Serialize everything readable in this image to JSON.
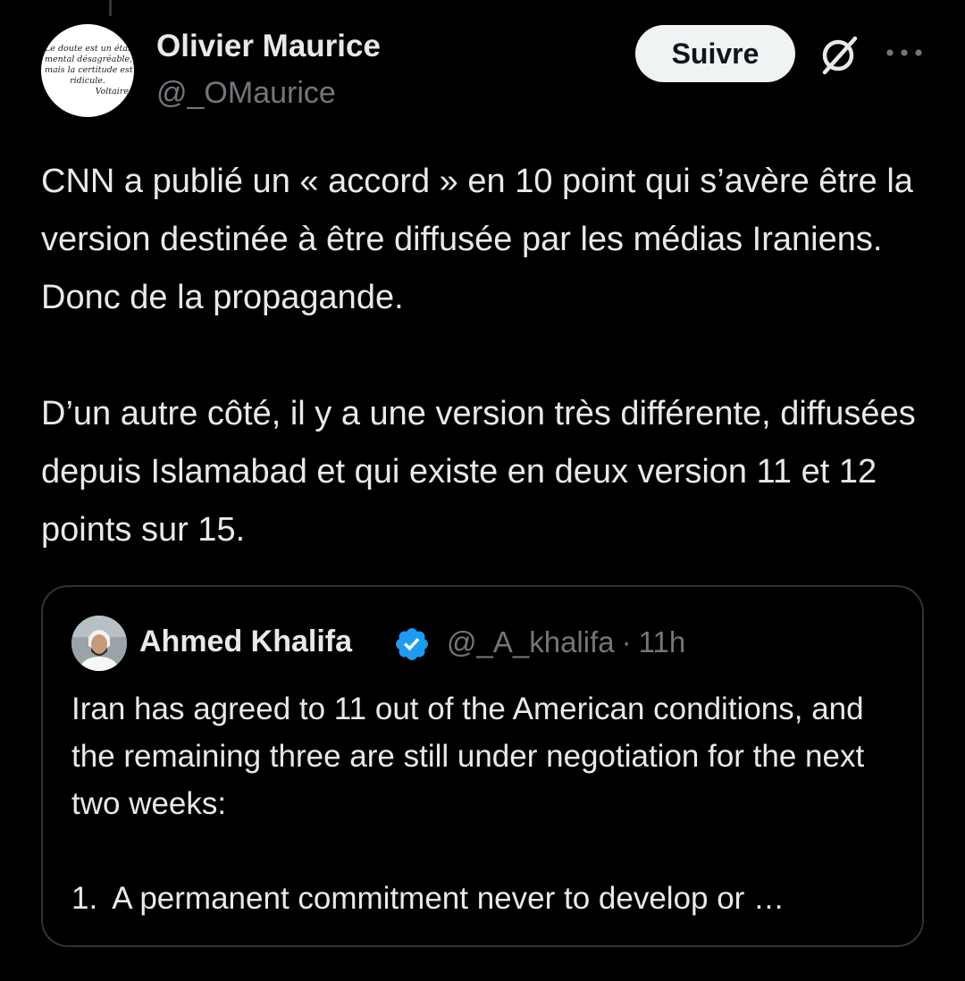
{
  "author": {
    "name": "Olivier Maurice",
    "handle": "@_OMaurice",
    "avatar_text": [
      "Le doute est un état",
      "mental désagréable,",
      "mais la certitude est",
      "ridicule.",
      "Voltaire"
    ]
  },
  "actions": {
    "follow_label": "Suivre",
    "grok_icon": "grok-icon",
    "more_icon": "more-icon"
  },
  "tweet": {
    "paragraphs": [
      "CNN a publié un « accord » en 10 point qui s’avère être la version destinée à être diffusée par les médias Iraniens. Donc de la propagande.",
      "D’un autre côté, il y a une version très différente, diffusées depuis Islamabad et qui existe en deux version 11 et 12 points sur 15."
    ]
  },
  "quote": {
    "name": "Ahmed Khalifa",
    "verified": true,
    "handle": "@_A_khalifa",
    "separator": "·",
    "time": "11h",
    "paragraph": "Iran has agreed to 11 out of the American conditions, and the remaining three are still under negotiation for the next two weeks:",
    "list_item_number": "1.",
    "list_item_text": "A permanent commitment never to develop or …"
  },
  "colors": {
    "background": "#000000",
    "text_primary": "#e7e9ea",
    "text_secondary": "#71767b",
    "border": "#2f3336",
    "follow_bg": "#eff3f4",
    "verified_blue": "#1d9bf0"
  }
}
